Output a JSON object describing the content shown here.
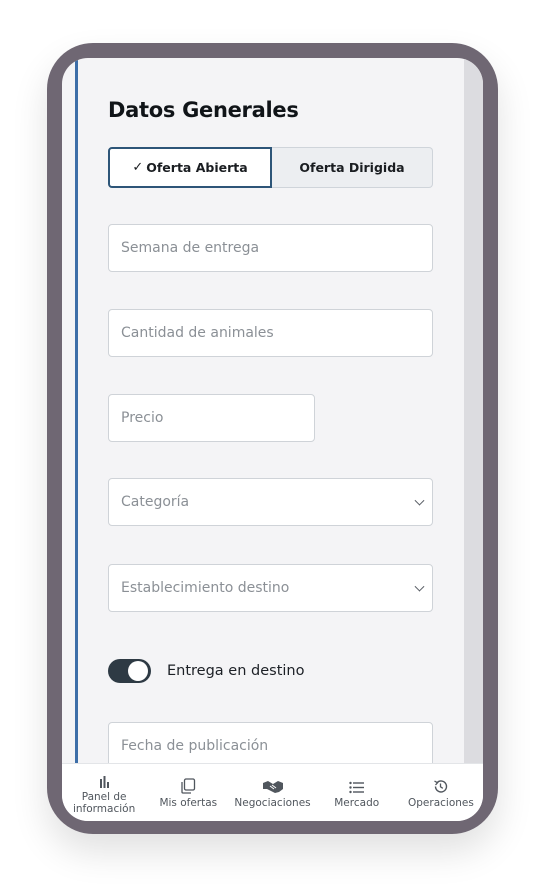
{
  "form": {
    "title": "Datos Generales",
    "offer_toggle": {
      "open_label": "Oferta Abierta",
      "directed_label": "Oferta Dirigida",
      "selected": "Oferta Abierta",
      "check_icon": "check-icon"
    },
    "fields": {
      "delivery_week_placeholder": "Semana de entrega",
      "animal_quantity_placeholder": "Cantidad de animales",
      "price_placeholder": "Precio",
      "category_placeholder": "Categoría",
      "destination_placeholder": "Establecimiento destino",
      "publication_date_placeholder": "Fecha de publicación"
    },
    "delivery_switch": {
      "label": "Entrega en destino",
      "on": true
    }
  },
  "bottom_nav": {
    "items": [
      {
        "label": "Panel de información",
        "icon": "bar-chart-icon"
      },
      {
        "label": "Mis ofertas",
        "icon": "copy-icon"
      },
      {
        "label": "Negociaciones",
        "icon": "handshake-icon"
      },
      {
        "label": "Mercado",
        "icon": "list-icon"
      },
      {
        "label": "Operaciones",
        "icon": "history-icon"
      }
    ]
  },
  "colors": {
    "frame": "#6f6773",
    "accent_blue": "#3d6ea8",
    "active_border": "#2d5578",
    "switch_on": "#2e3a44",
    "screen_bg": "#f4f4f6"
  }
}
